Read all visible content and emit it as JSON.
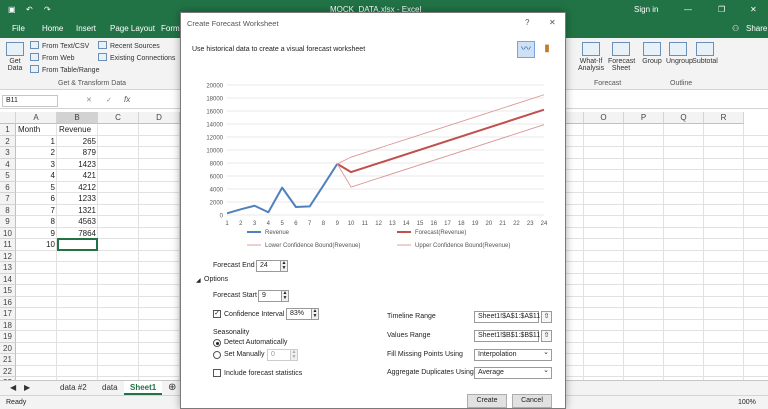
{
  "window": {
    "title": "MOCK_DATA.xlsx - Excel",
    "signin": "Sign in",
    "share": "Share"
  },
  "ribbon_tabs": [
    "File",
    "Home",
    "Insert",
    "Page Layout",
    "Form"
  ],
  "ribbon": {
    "get_data": "Get Data",
    "from_text": "From Text/CSV",
    "from_web": "From Web",
    "from_table": "From Table/Range",
    "recent_sources": "Recent Sources",
    "existing_connections": "Existing Connections",
    "group_get_transform": "Get & Transform Data",
    "whatif": "What-If Analysis",
    "forecast_sheet": "Forecast Sheet",
    "group_forecast": "Forecast",
    "group_btn": "Group",
    "ungroup_btn": "Ungroup",
    "subtotal_btn": "Subtotal",
    "group_outline": "Outline"
  },
  "formula": {
    "namebox": "B11",
    "fx": "fx"
  },
  "columns_left": [
    "A",
    "B",
    "C",
    "D"
  ],
  "columns_right": [
    "O",
    "P",
    "Q",
    "R"
  ],
  "rows": [
    "1",
    "2",
    "3",
    "4",
    "5",
    "6",
    "7",
    "8",
    "9",
    "10",
    "11",
    "12",
    "13",
    "14",
    "15",
    "16",
    "17",
    "18",
    "19",
    "20",
    "21",
    "22",
    "23"
  ],
  "table": {
    "header": [
      "Month",
      "Revenue"
    ],
    "rows": [
      [
        "1",
        "265"
      ],
      [
        "2",
        "879"
      ],
      [
        "3",
        "1423"
      ],
      [
        "4",
        "421"
      ],
      [
        "5",
        "4212"
      ],
      [
        "6",
        "1233"
      ],
      [
        "7",
        "1321"
      ],
      [
        "8",
        "4563"
      ],
      [
        "9",
        "7864"
      ],
      [
        "10",
        ""
      ]
    ]
  },
  "sheet_tabs": [
    "data #2",
    "data",
    "Sheet1"
  ],
  "status": {
    "ready": "Ready",
    "zoom": "100%"
  },
  "dialog": {
    "title": "Create Forecast Worksheet",
    "description": "Use historical data to create a visual forecast worksheet",
    "forecast_end_label": "Forecast End",
    "forecast_end_value": "24",
    "options_label": "Options",
    "forecast_start_label": "Forecast Start",
    "forecast_start_value": "9",
    "confidence_label": "Confidence Interval",
    "confidence_value": "83%",
    "seasonality_label": "Seasonality",
    "detect_auto_label": "Detect Automatically",
    "set_manually_label": "Set Manually",
    "set_manually_value": "0",
    "include_stats_label": "Include forecast statistics",
    "timeline_range_label": "Timeline Range",
    "timeline_range_value": "Sheet1!$A$1:$A$11",
    "values_range_label": "Values Range",
    "values_range_value": "Sheet1!$B$1:$B$11",
    "fill_missing_label": "Fill Missing Points Using",
    "fill_missing_value": "Interpolation",
    "aggregate_label": "Aggregate Duplicates Using",
    "aggregate_value": "Average",
    "create_button": "Create",
    "cancel_button": "Cancel",
    "help_glyph": "?",
    "close_glyph": "✕"
  },
  "chart_data": {
    "type": "line",
    "x": [
      1,
      2,
      3,
      4,
      5,
      6,
      7,
      8,
      9,
      10,
      11,
      12,
      13,
      14,
      15,
      16,
      17,
      18,
      19,
      20,
      21,
      22,
      23,
      24
    ],
    "ylim": [
      0,
      20000
    ],
    "yticks": [
      0,
      2000,
      4000,
      6000,
      8000,
      10000,
      12000,
      14000,
      16000,
      18000,
      20000
    ],
    "grid": true,
    "legend_position": "bottom",
    "series": [
      {
        "name": "Revenue",
        "color": "#4e81bd",
        "x": [
          1,
          2,
          3,
          4,
          5,
          6,
          7,
          8,
          9
        ],
        "values": [
          265,
          879,
          1423,
          421,
          4212,
          1233,
          1321,
          4563,
          7864
        ]
      },
      {
        "name": "Forecast(Revenue)",
        "color": "#c0504d",
        "x": [
          9,
          10,
          24
        ],
        "values": [
          7864,
          6600,
          16200
        ]
      },
      {
        "name": "Lower Confidence Bound(Revenue)",
        "color": "#d99694",
        "x": [
          9,
          10,
          24
        ],
        "values": [
          7864,
          4300,
          13900
        ]
      },
      {
        "name": "Upper Confidence Bound(Revenue)",
        "color": "#d99694",
        "x": [
          9,
          10,
          24
        ],
        "values": [
          7864,
          8900,
          18500
        ]
      }
    ]
  }
}
